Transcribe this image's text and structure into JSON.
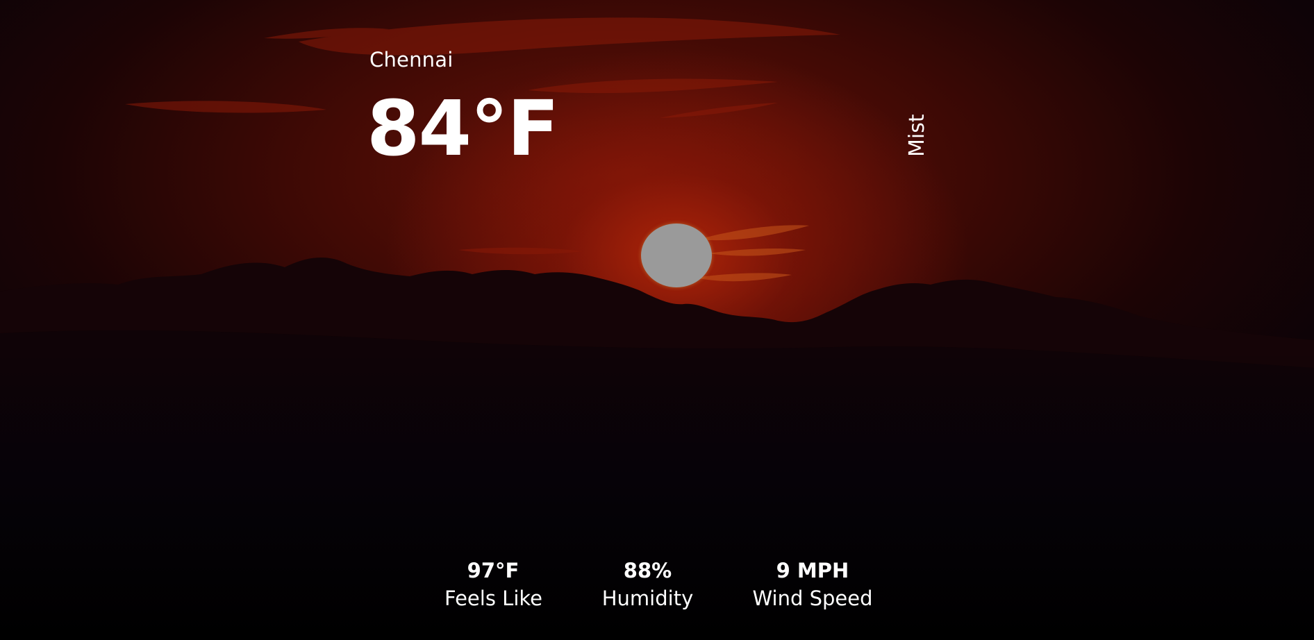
{
  "weather": {
    "city": "Chennai",
    "temperature": "84°F",
    "condition": "Mist"
  },
  "stats": [
    {
      "value": "97°F",
      "label": "Feels Like"
    },
    {
      "value": "88%",
      "label": "Humidity"
    },
    {
      "value": "9 MPH",
      "label": "Wind Speed"
    }
  ],
  "colors": {
    "text": "#ffffff",
    "sky_glow": "#be280a",
    "sun": "#9a9a9a",
    "ground": "#000000"
  },
  "background": {
    "scene": "sunset-sky-photo"
  }
}
